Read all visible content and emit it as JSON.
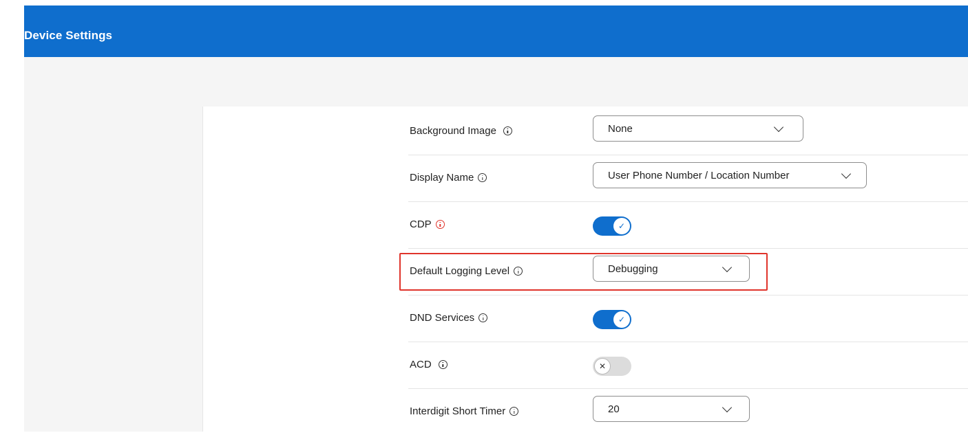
{
  "header": {
    "title": "Device Settings"
  },
  "settings": {
    "background_image": {
      "label": "Background Image",
      "value": "None"
    },
    "display_name": {
      "label": "Display Name",
      "value": "User Phone Number / Location Number"
    },
    "cdp": {
      "label": "CDP",
      "enabled": true
    },
    "default_logging_level": {
      "label": "Default Logging Level",
      "value": "Debugging"
    },
    "dnd_services": {
      "label": "DND Services",
      "enabled": true
    },
    "acd": {
      "label": "ACD",
      "enabled": false
    },
    "interdigit_short_timer": {
      "label": "Interdigit Short Timer",
      "value": "20"
    }
  },
  "icons": {
    "toggle_on_glyph": "✓",
    "toggle_off_glyph": "✕"
  },
  "colors": {
    "header_bg": "#0f6ecd",
    "toggle_on": "#0f6ecd",
    "toggle_off": "#dcdcdc",
    "highlight": "#e0342b",
    "cdp_info_icon": "#e0342b"
  }
}
